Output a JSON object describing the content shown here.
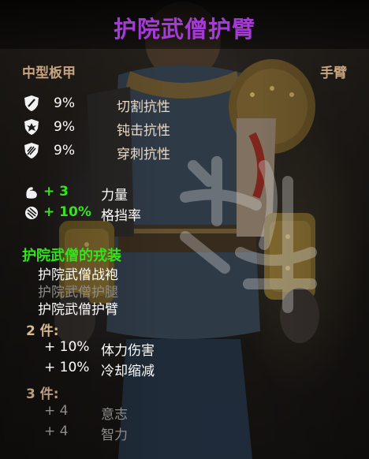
{
  "item": {
    "title": "护院武僧护臂",
    "title_color": "#a63ad6",
    "armor_type": "中型板甲",
    "slot": "手臂"
  },
  "resistances": [
    {
      "icon": "slash-shield-icon",
      "value": "9%",
      "name": "切割抗性"
    },
    {
      "icon": "blunt-shield-icon",
      "value": "9%",
      "name": "钝击抗性"
    },
    {
      "icon": "pierce-shield-icon",
      "value": "9%",
      "name": "穿刺抗性"
    }
  ],
  "bonuses": [
    {
      "icon": "strength-arm-icon",
      "value": "+ 3",
      "name": "力量"
    },
    {
      "icon": "parry-shield-icon",
      "value": "+ 10%",
      "name": "格挡率"
    }
  ],
  "set": {
    "name": "护院武僧的戎装",
    "name_color": "#31e41b",
    "pieces": [
      {
        "name": "护院武僧战袍",
        "owned": true
      },
      {
        "name": "护院武僧护腿",
        "owned": false
      },
      {
        "name": "护院武僧护臂",
        "owned": true
      }
    ],
    "tiers": [
      {
        "label": "2 件:",
        "active": true,
        "effects": [
          {
            "value": "+ 10%",
            "name": "体力伤害"
          },
          {
            "value": "+ 10%",
            "name": "冷却缩减"
          }
        ]
      },
      {
        "label": "3 件:",
        "active": false,
        "effects": [
          {
            "value": "+ 4",
            "name": "意志"
          },
          {
            "value": "+ 4",
            "name": "智力"
          }
        ]
      }
    ]
  }
}
